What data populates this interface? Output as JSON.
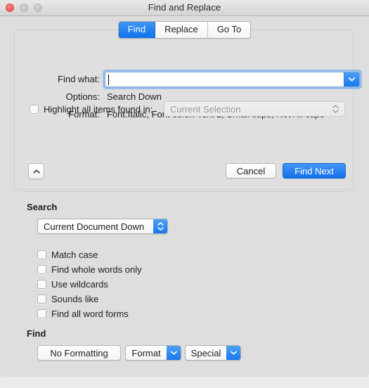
{
  "window": {
    "title": "Find and Replace",
    "traffic_lights": [
      {
        "name": "close",
        "state": "active",
        "color": "#fa6158"
      },
      {
        "name": "minimize",
        "state": "disabled",
        "color": "#c5c5c5"
      },
      {
        "name": "maximize",
        "state": "disabled",
        "color": "#c5c5c5"
      }
    ]
  },
  "tabs": [
    {
      "label": "Find",
      "active": true
    },
    {
      "label": "Replace",
      "active": false
    },
    {
      "label": "Go To",
      "active": false
    }
  ],
  "find_panel": {
    "find_what_label": "Find what:",
    "find_what_value": "",
    "find_what_placeholder": "",
    "find_what_focused": true,
    "options_label": "Options:",
    "options_value": "Search Down",
    "format_label": "Format:",
    "format_value": "Font:Italic, Font color: Text 1, Small caps, Not All caps",
    "highlight_label": "Highlight all items found in:",
    "highlight_checked": false,
    "highlight_scope_value": "Current Selection",
    "highlight_scope_enabled": false,
    "disclosure_icon": "chevron-up-icon",
    "cancel_label": "Cancel",
    "find_next_label": "Find Next"
  },
  "search_section": {
    "title": "Search",
    "direction_value": "Current Document Down",
    "options": [
      {
        "label": "Match case",
        "checked": false
      },
      {
        "label": "Find whole words only",
        "checked": false
      },
      {
        "label": "Use wildcards",
        "checked": false
      },
      {
        "label": "Sounds like",
        "checked": false
      },
      {
        "label": "Find all word forms",
        "checked": false
      }
    ]
  },
  "find_section": {
    "title": "Find",
    "no_formatting_label": "No Formatting",
    "format_label": "Format",
    "special_label": "Special"
  },
  "colors": {
    "accent_blue": "#1272ec",
    "window_bg": "#dedede",
    "panel_bg": "#dfdfdf",
    "desktop_bg": "#ebebeb",
    "text": "#1d1d1d",
    "disabled_text": "#9a9a9a"
  }
}
